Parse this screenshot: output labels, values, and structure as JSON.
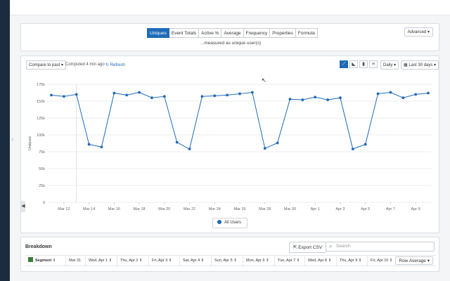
{
  "metric_tabs": [
    "Uniques",
    "Event Totals",
    "Active %",
    "Average",
    "Frequency",
    "Properties",
    "Formula"
  ],
  "active_tab": "Uniques",
  "measured_text": "...measured as unique user(s)",
  "advanced_label": "Advanced",
  "toolbar": {
    "compare_label": "Compare to past",
    "computed_text": "Computed 4 min ago",
    "refresh_label": "Refresh",
    "interval_label": "Daily",
    "range_label": "Last 30 days"
  },
  "chart_types": [
    "line-chart-icon",
    "area-chart-icon",
    "bar-chart-icon",
    "stacked-bar-icon"
  ],
  "chart_data": {
    "type": "line",
    "ylabel": "Uniques",
    "ylim": [
      0,
      175000
    ],
    "yticks": [
      0,
      25000,
      50000,
      75000,
      100000,
      125000,
      150000,
      175000
    ],
    "ytick_labels": [
      "0",
      "25k",
      "50k",
      "75k",
      "100k",
      "125k",
      "150k",
      "175k"
    ],
    "xtick_labels": [
      "Mar 12",
      "Mar 14",
      "Mar 16",
      "Mar 18",
      "Mar 20",
      "Mar 22",
      "Mar 24",
      "Mar 26",
      "Mar 28",
      "Mar 30",
      "Apr 1",
      "Apr 3",
      "Apr 5",
      "Apr 7",
      "Apr 9"
    ],
    "series": [
      {
        "name": "All Users",
        "color": "#1e6bb8",
        "values": [
          159000,
          157000,
          160000,
          86000,
          82000,
          162000,
          159000,
          163000,
          155000,
          157000,
          89000,
          79000,
          157000,
          158000,
          159000,
          161000,
          163000,
          80000,
          88000,
          153000,
          152000,
          156000,
          152000,
          155000,
          79000,
          86000,
          161000,
          163000,
          155000,
          160000,
          162000
        ]
      }
    ]
  },
  "legend_label": "All Users",
  "breakdown": {
    "title": "Breakdown",
    "export_label": "Export CSV",
    "search_placeholder": "Search",
    "row_avg_label": "Row Average",
    "columns": [
      "Segment",
      "Mar 31",
      "Wed, Apr 1",
      "Thu, Apr 2",
      "Fri, Apr 3",
      "Sat, Apr 4",
      "Sun, Apr 5",
      "Mon, Apr 6",
      "Tue, Apr 7",
      "Wed, Apr 8",
      "Thu, Apr 9",
      "Fri, Apr 10"
    ]
  }
}
